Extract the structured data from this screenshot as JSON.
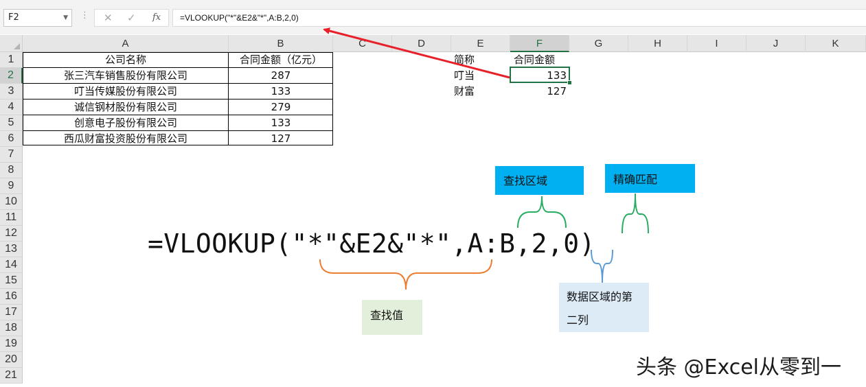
{
  "formula_bar": {
    "name_box": "F2",
    "dots": "⋮",
    "cancel_glyph": "✕",
    "enter_glyph": "✓",
    "fx_label": "fx",
    "formula": "=VLOOKUP(\"*\"&E2&\"*\",A:B,2,0)"
  },
  "columns": [
    "A",
    "B",
    "C",
    "D",
    "E",
    "F",
    "G",
    "H",
    "I",
    "J",
    "K"
  ],
  "rows": [
    "1",
    "2",
    "3",
    "4",
    "5",
    "6",
    "7",
    "8",
    "9",
    "10",
    "11",
    "12",
    "13",
    "14",
    "15",
    "16",
    "17",
    "18",
    "19",
    "20",
    "21"
  ],
  "table": {
    "headers": [
      "公司名称",
      "合同金额（亿元）"
    ],
    "rows": [
      [
        "张三汽车销售股份有限公司",
        "287"
      ],
      [
        "叮当传媒股份有限公司",
        "133"
      ],
      [
        "诚信钢材股份有限公司",
        "279"
      ],
      [
        "创意电子股份有限公司",
        "133"
      ],
      [
        "西瓜财富投资股份有限公司",
        "127"
      ]
    ]
  },
  "lookup": {
    "headers": [
      "简称",
      "合同金额"
    ],
    "rows": [
      [
        "叮当",
        "133"
      ],
      [
        "财富",
        "127"
      ]
    ]
  },
  "selected": {
    "column": "F",
    "row": "2"
  },
  "annotation": {
    "formula": "=VLOOKUP(\"*\"&E2&\"*\",A:B,2,0)",
    "range_label": "查找区域",
    "exact_label": "精确匹配",
    "lookup_value_label": "查找值",
    "column_label_line1": "数据区域的第",
    "column_label_line2": "二列"
  },
  "watermark": "头条 @Excel从零到一",
  "colors": {
    "accent_green": "#217346",
    "arrow_red": "#e8202a",
    "brace_orange": "#ed7d31",
    "brace_green": "#27ae60",
    "brace_blue": "#5b9bd5",
    "box_cyan": "#00b0f0",
    "box_light_green": "#e2efda",
    "box_light_blue": "#ddebf7"
  }
}
